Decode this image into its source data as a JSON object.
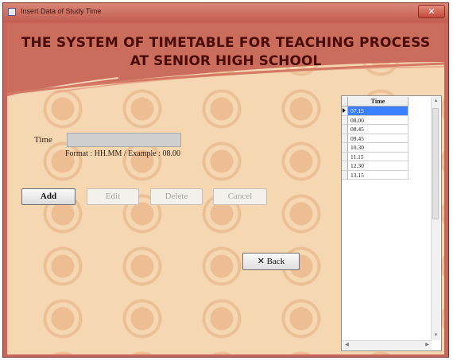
{
  "window": {
    "title": "Insert Data of Study Time",
    "close_icon": "✕"
  },
  "header": {
    "line1": "THE SYSTEM OF TIMETABLE FOR TEACHING PROCESS",
    "line2": "AT SENIOR HIGH SCHOOL"
  },
  "form": {
    "time_label": "Time",
    "time_value": "",
    "format_hint": "Format : HH.MM / Example : 08.00"
  },
  "buttons": {
    "add": "Add",
    "edit": "Edit",
    "delete": "Delete",
    "cancel": "Cancel",
    "back": "✕ Back"
  },
  "grid": {
    "column_header": "Time",
    "rows": [
      "07.15",
      "08.00",
      "08.45",
      "09.45",
      "10.30",
      "11.15",
      "12.30",
      "13.15"
    ],
    "selected_index": 0
  },
  "colors": {
    "title_bar": "#c25d4f",
    "background": "#f5d7b2",
    "heading_text": "#4a0c08",
    "selection": "#3a80ff"
  }
}
